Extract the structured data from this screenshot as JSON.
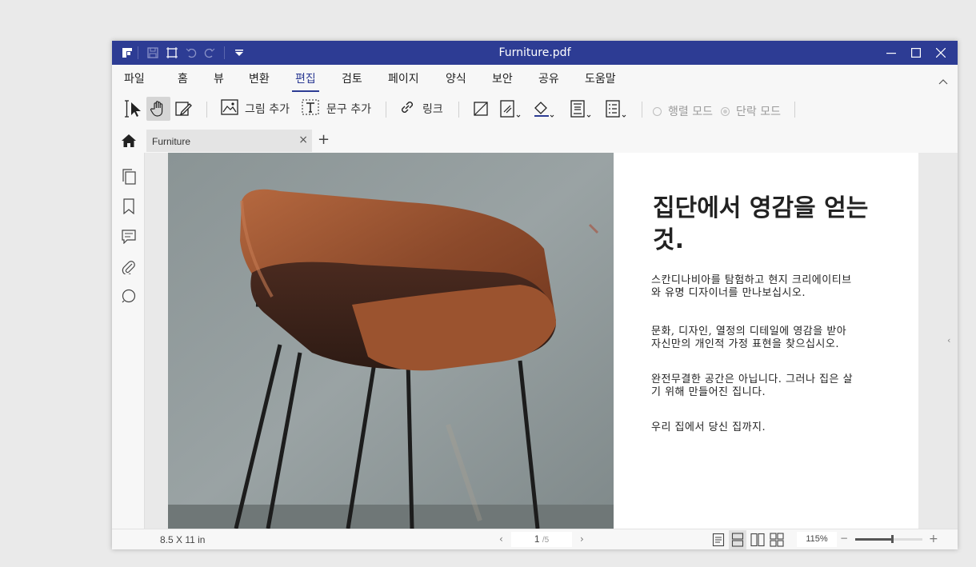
{
  "window": {
    "title": "Furniture.pdf"
  },
  "menu": {
    "items": [
      {
        "label": "파일"
      },
      {
        "label": "홈"
      },
      {
        "label": "뷰"
      },
      {
        "label": "변환"
      },
      {
        "label": "편집"
      },
      {
        "label": "검토"
      },
      {
        "label": "페이지"
      },
      {
        "label": "양식"
      },
      {
        "label": "보안"
      },
      {
        "label": "공유"
      },
      {
        "label": "도움말"
      }
    ],
    "active": "편집"
  },
  "toolbar": {
    "add_image_label": "그림 추가",
    "add_text_label": "문구 추가",
    "link_label": "링크",
    "line_mode_label": "행렬 모드",
    "paragraph_mode_label": "단락 모드"
  },
  "tabs": {
    "doc_tab_label": "Furniture",
    "close_symbol": "×",
    "new_tab_symbol": "+"
  },
  "document": {
    "heading": "집단에서 영감을 얻는것.",
    "paragraphs": [
      "스칸디나비아를 탐험하고 현지 크리에이티브와 유명 디자이너를 만나보십시오.",
      "문화, 디자인, 열정의 디테일에 영감을 받아 자신만의 개인적 가정 표현을 찾으십시오.",
      "완전무결한 공간은 아닙니다. 그러나 집은 살기 위해 만들어진 집니다.",
      "우리 집에서 당신 집까지."
    ]
  },
  "status": {
    "page_size": "8.5 X 11 in",
    "current_page": "1",
    "total_pages": "/5",
    "zoom": "115%",
    "zoom_fraction": 0.55,
    "zoom_minus": "−",
    "zoom_plus": "+"
  },
  "colors": {
    "titlebar": "#2d3c94",
    "accent": "#2d3c94"
  }
}
